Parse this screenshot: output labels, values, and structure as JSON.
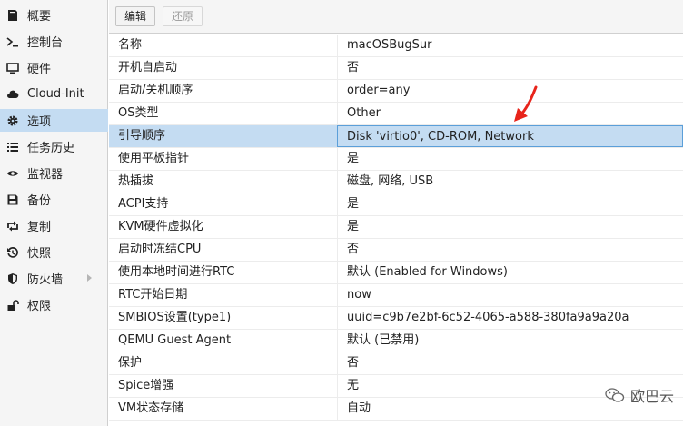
{
  "sidebar": {
    "items": [
      {
        "label": "概要",
        "icon": "book-icon"
      },
      {
        "label": "控制台",
        "icon": "terminal-icon"
      },
      {
        "label": "硬件",
        "icon": "monitor-icon"
      },
      {
        "label": "Cloud-Init",
        "icon": "cloud-icon"
      },
      {
        "label": "选项",
        "icon": "gear-icon"
      },
      {
        "label": "任务历史",
        "icon": "list-icon"
      },
      {
        "label": "监视器",
        "icon": "eye-icon"
      },
      {
        "label": "备份",
        "icon": "floppy-icon"
      },
      {
        "label": "复制",
        "icon": "retweet-icon"
      },
      {
        "label": "快照",
        "icon": "history-icon"
      },
      {
        "label": "防火墙",
        "icon": "shield-icon"
      },
      {
        "label": "权限",
        "icon": "unlock-icon"
      }
    ],
    "active_index": 4
  },
  "toolbar": {
    "edit_label": "编辑",
    "revert_label": "还原"
  },
  "options": [
    {
      "key": "名称",
      "value": "macOSBugSur"
    },
    {
      "key": "开机自启动",
      "value": "否"
    },
    {
      "key": "启动/关机顺序",
      "value": "order=any"
    },
    {
      "key": "OS类型",
      "value": "Other"
    },
    {
      "key": "引导顺序",
      "value": "Disk 'virtio0', CD-ROM, Network"
    },
    {
      "key": "使用平板指针",
      "value": "是"
    },
    {
      "key": "热插拔",
      "value": "磁盘, 网络, USB"
    },
    {
      "key": "ACPI支持",
      "value": "是"
    },
    {
      "key": "KVM硬件虚拟化",
      "value": "是"
    },
    {
      "key": "启动时冻结CPU",
      "value": "否"
    },
    {
      "key": "使用本地时间进行RTC",
      "value": "默认 (Enabled for Windows)"
    },
    {
      "key": "RTC开始日期",
      "value": "now"
    },
    {
      "key": "SMBIOS设置(type1)",
      "value": "uuid=c9b7e2bf-6c52-4065-a588-380fa9a9a20a"
    },
    {
      "key": "QEMU Guest Agent",
      "value": "默认 (已禁用)"
    },
    {
      "key": "保护",
      "value": "否"
    },
    {
      "key": "Spice增强",
      "value": "无"
    },
    {
      "key": "VM状态存储",
      "value": "自动"
    }
  ],
  "selected_row_index": 4,
  "watermark": {
    "text": "欧巴云"
  },
  "colors": {
    "selection": "#c4dcf2",
    "selection_border": "#5b9fd9",
    "arrow": "#e8241b"
  }
}
